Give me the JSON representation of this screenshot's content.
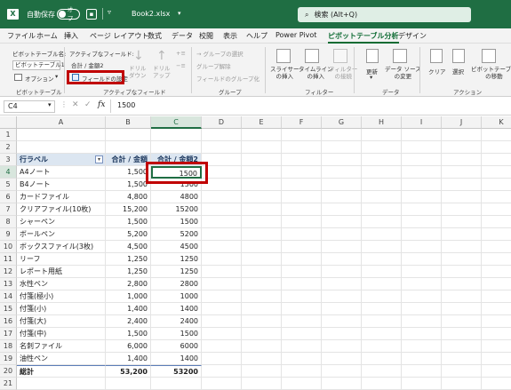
{
  "titlebar": {
    "autosave_label": "自動保存",
    "autosave_state": "オフ",
    "filename": "Book2.xlsx",
    "search_placeholder": "検索 (Alt+Q)"
  },
  "menu": [
    "ファイル",
    "ホーム",
    "挿入",
    "ページ レイアウト",
    "数式",
    "データ",
    "校閲",
    "表示",
    "ヘルプ",
    "Power Pivot",
    "ピボットテーブル分析",
    "デザイン"
  ],
  "ribbon": {
    "pivot_name_label": "ピボットテーブル名:",
    "pivot_name_value": "ピボットテーブル1",
    "options_label": "オプション",
    "group_pivot": "ピボットテーブル",
    "active_field_label": "アクティブなフィールド:",
    "active_field_value": "合計 / 金額2",
    "field_settings": "フィールドの設定",
    "drilldown": "ドリル\nダウン",
    "drillup": "ドリル\nアップ",
    "group_active": "アクティブなフィールド",
    "group_selection": "→ グループの選択",
    "ungroup": "グループ解除",
    "group_field": "フィールドのグループ化",
    "group_group": "グループ",
    "slicer": "スライサー\nの挿入",
    "timeline": "タイムライン\nの挿入",
    "filter_conn": "フィルター\nの接続",
    "group_filter": "フィルター",
    "refresh": "更新",
    "datasource": "データ ソース\nの変更",
    "group_data": "データ",
    "clear": "クリア",
    "select": "選択",
    "move": "ピボットテーブル\nの移動",
    "group_action": "アクション"
  },
  "formula": {
    "namebox": "C4",
    "fx": "fx",
    "value": "1500"
  },
  "columns": [
    "A",
    "B",
    "C",
    "D",
    "E",
    "F",
    "G",
    "H",
    "I",
    "J",
    "K"
  ],
  "rows": [
    {
      "n": "1",
      "a": "",
      "b": "",
      "c": ""
    },
    {
      "n": "2",
      "a": "",
      "b": "",
      "c": ""
    },
    {
      "n": "3",
      "a": "行ラベル",
      "b": "合計 / 金額",
      "c": "合計 / 金額2"
    },
    {
      "n": "4",
      "a": "A4ノート",
      "b": "1,500",
      "c": "1500"
    },
    {
      "n": "5",
      "a": "B4ノート",
      "b": "1,500",
      "c": "1500"
    },
    {
      "n": "6",
      "a": "カードファイル",
      "b": "4,800",
      "c": "4800"
    },
    {
      "n": "7",
      "a": "クリアファイル(10枚)",
      "b": "15,200",
      "c": "15200"
    },
    {
      "n": "8",
      "a": "シャーペン",
      "b": "1,500",
      "c": "1500"
    },
    {
      "n": "9",
      "a": "ボールペン",
      "b": "5,200",
      "c": "5200"
    },
    {
      "n": "10",
      "a": "ボックスファイル(3枚)",
      "b": "4,500",
      "c": "4500"
    },
    {
      "n": "11",
      "a": "リーフ",
      "b": "1,250",
      "c": "1250"
    },
    {
      "n": "12",
      "a": "レポート用紙",
      "b": "1,250",
      "c": "1250"
    },
    {
      "n": "13",
      "a": "水性ペン",
      "b": "2,800",
      "c": "2800"
    },
    {
      "n": "14",
      "a": "付箋(極小)",
      "b": "1,000",
      "c": "1000"
    },
    {
      "n": "15",
      "a": "付箋(小)",
      "b": "1,400",
      "c": "1400"
    },
    {
      "n": "16",
      "a": "付箋(大)",
      "b": "2,400",
      "c": "2400"
    },
    {
      "n": "17",
      "a": "付箋(中)",
      "b": "1,500",
      "c": "1500"
    },
    {
      "n": "18",
      "a": "名刺ファイル",
      "b": "6,000",
      "c": "6000"
    },
    {
      "n": "19",
      "a": "油性ペン",
      "b": "1,400",
      "c": "1400"
    },
    {
      "n": "20",
      "a": "総計",
      "b": "53,200",
      "c": "53200"
    },
    {
      "n": "21",
      "a": "",
      "b": "",
      "c": ""
    }
  ],
  "colors": {
    "excel_green": "#1f6e43",
    "highlight": "#c00000",
    "pivot_header": "#dce6f1"
  }
}
